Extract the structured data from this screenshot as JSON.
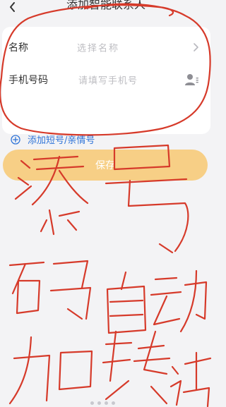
{
  "header": {
    "title": "添加智能联系人"
  },
  "form": {
    "name_label": "名称",
    "name_placeholder": "选择名称",
    "phone_label": "手机号码",
    "phone_placeholder": "请填写手机号",
    "add_link": "添加短号/亲情号"
  },
  "actions": {
    "save_label": "保存"
  },
  "colors": {
    "background": "#f3f3f5",
    "card": "#ffffff",
    "link_blue": "#2f74d8",
    "save_button": "#f7cf86",
    "annotation_red": "#d63a2a"
  },
  "icons": {
    "back": "chevron-left-icon",
    "name_row": "chevron-right-icon",
    "phone_row": "contact-book-icon",
    "add_link": "plus-circle-icon"
  }
}
